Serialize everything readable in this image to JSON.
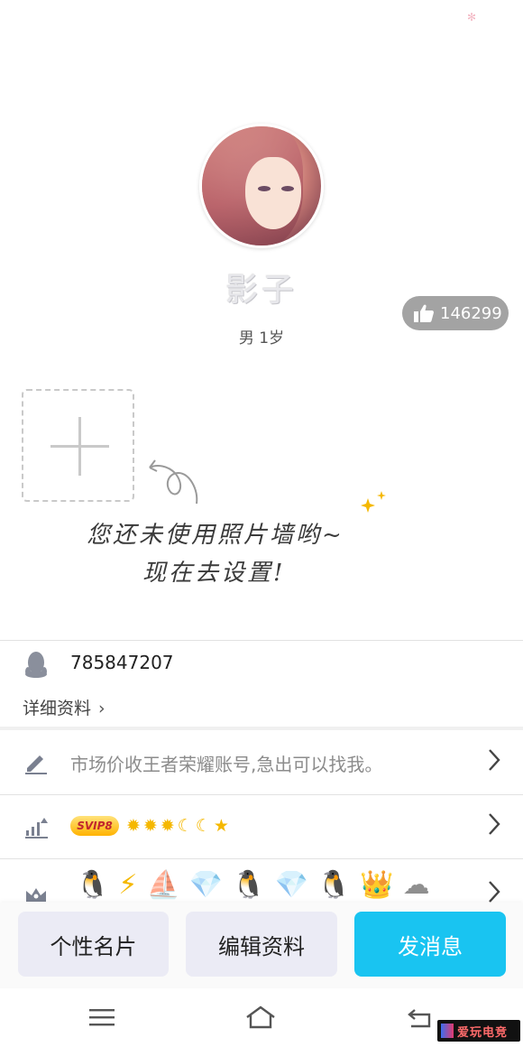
{
  "profile": {
    "nickname": "影子",
    "gender_age": "男 1岁",
    "likes": "146299"
  },
  "photo_wall": {
    "hint_line1": "您还未使用照片墙哟~",
    "hint_line2": "现在去设置!"
  },
  "account": {
    "qq_number": "785847207",
    "detail_link": "详细资料"
  },
  "signature": {
    "text": "市场价收王者荣耀账号,急出可以找我。"
  },
  "vip": {
    "badge": "SVIP8"
  },
  "actions": {
    "card_button": "个性名片",
    "edit_button": "编辑资料",
    "message_button": "发消息"
  },
  "watermark": {
    "text": "爱玩电竞"
  },
  "colors": {
    "primary": "#19c4f1",
    "secondary_button": "#ebebf5",
    "like_badge": "#a3a3a3"
  }
}
